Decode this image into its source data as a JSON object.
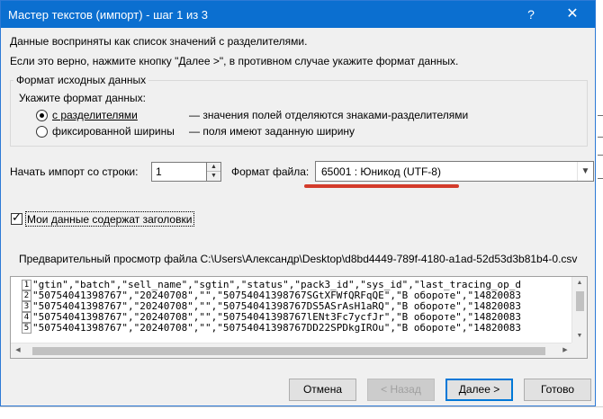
{
  "dialog": {
    "title": "Мастер текстов (импорт) - шаг 1 из 3",
    "help_glyph": "?",
    "close_glyph": "✕"
  },
  "intro": {
    "line1": "Данные восприняты как список значений с разделителями.",
    "line2": "Если это верно, нажмите кнопку \"Далее >\", в противном случае укажите формат данных."
  },
  "source_format": {
    "legend": "Формат исходных данных",
    "prompt": "Укажите формат данных:",
    "options": [
      {
        "label": "с разделителями",
        "description": "— значения полей отделяются знаками-разделителями",
        "selected": true
      },
      {
        "label": "фиксированной ширины",
        "description": "— поля имеют заданную ширину",
        "selected": false
      }
    ]
  },
  "start_row": {
    "label": "Начать импорт со строки:",
    "value": "1"
  },
  "file_origin": {
    "label": "Формат файла:",
    "value": "65001 : Юникод (UTF-8)",
    "highlight_color": "#d33b2b"
  },
  "headers_checkbox": {
    "label": "Мои данные содержат заголовки",
    "checked": true,
    "check_glyph": "✓"
  },
  "preview": {
    "label": "Предварительный просмотр файла C:\\Users\\Александр\\Desktop\\d8bd4449-789f-4180-a1ad-52d53d3b81b4-0.csv",
    "lines": [
      {
        "num": "1",
        "text": "\"gtin\",\"batch\",\"sell_name\",\"sgtin\",\"status\",\"pack3_id\",\"sys_id\",\"last_tracing_op_d"
      },
      {
        "num": "2",
        "text": "\"50754041398767\",\"20240708\",\"\",\"50754041398767SGtXFWfQRFqQE\",\"В обороте\",\"14820083"
      },
      {
        "num": "3",
        "text": "\"50754041398767\",\"20240708\",\"\",\"50754041398767DS5ASrAsH1aRQ\",\"В обороте\",\"14820083"
      },
      {
        "num": "4",
        "text": "\"50754041398767\",\"20240708\",\"\",\"50754041398767lENt3Fc7ycfJr\",\"В обороте\",\"14820083"
      },
      {
        "num": "5",
        "text": "\"50754041398767\",\"20240708\",\"\",\"50754041398767DD22SPDkgIROu\",\"В обороте\",\"14820083"
      }
    ]
  },
  "buttons": {
    "cancel": "Отмена",
    "back": "< Назад",
    "next": "Далее >",
    "finish": "Готово"
  },
  "colors": {
    "titlebar": "#0b6fd0",
    "dialog_bg": "#f0f0f0"
  }
}
